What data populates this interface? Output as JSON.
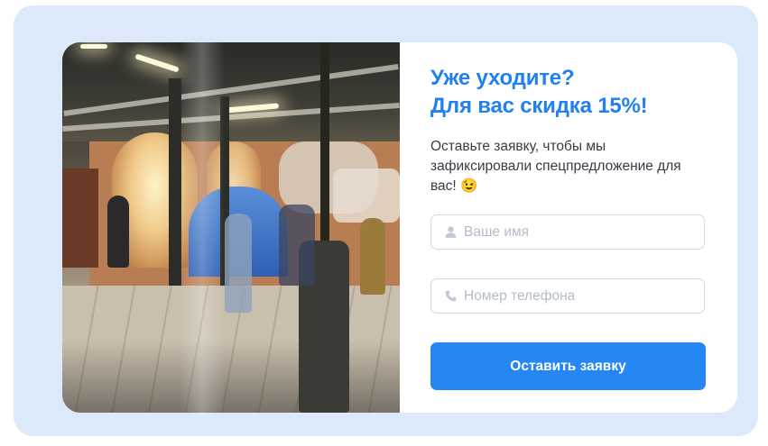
{
  "popup": {
    "title_line1": "Уже уходите?",
    "title_line2": "Для вас скидка 15%!",
    "description": "Оставьте заявку, чтобы мы зафиксировали спецпредложение для вас!",
    "description_emoji": "😉",
    "name_placeholder": "Ваше имя",
    "phone_placeholder": "Номер телефона",
    "submit_label": "Оставить заявку"
  },
  "icons": {
    "name_field": "user-icon",
    "phone_field": "phone-icon"
  },
  "colors": {
    "outer_background": "#dbe9fb",
    "card_background": "#ffffff",
    "accent": "#2280f1",
    "button": "#2487f3",
    "field_border": "#d3d8e2",
    "placeholder": "#b4bccb",
    "body_text": "#3a3a44"
  }
}
